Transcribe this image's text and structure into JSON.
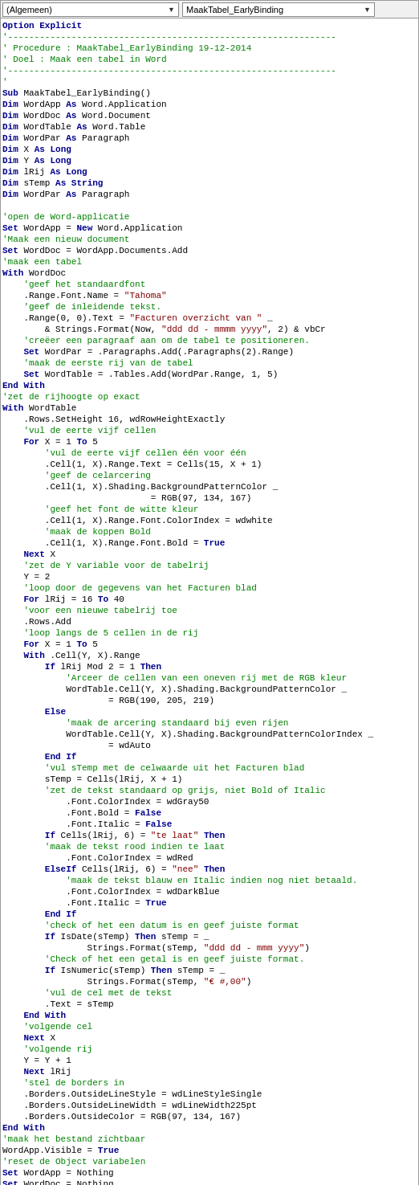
{
  "toolbar": {
    "dropdown1_label": "(Algemeen)",
    "dropdown2_label": "MaakTabel_EarlyBinding"
  },
  "bottom": {
    "next_label": "Next"
  },
  "code": {
    "option_explicit": "Option Explicit"
  }
}
